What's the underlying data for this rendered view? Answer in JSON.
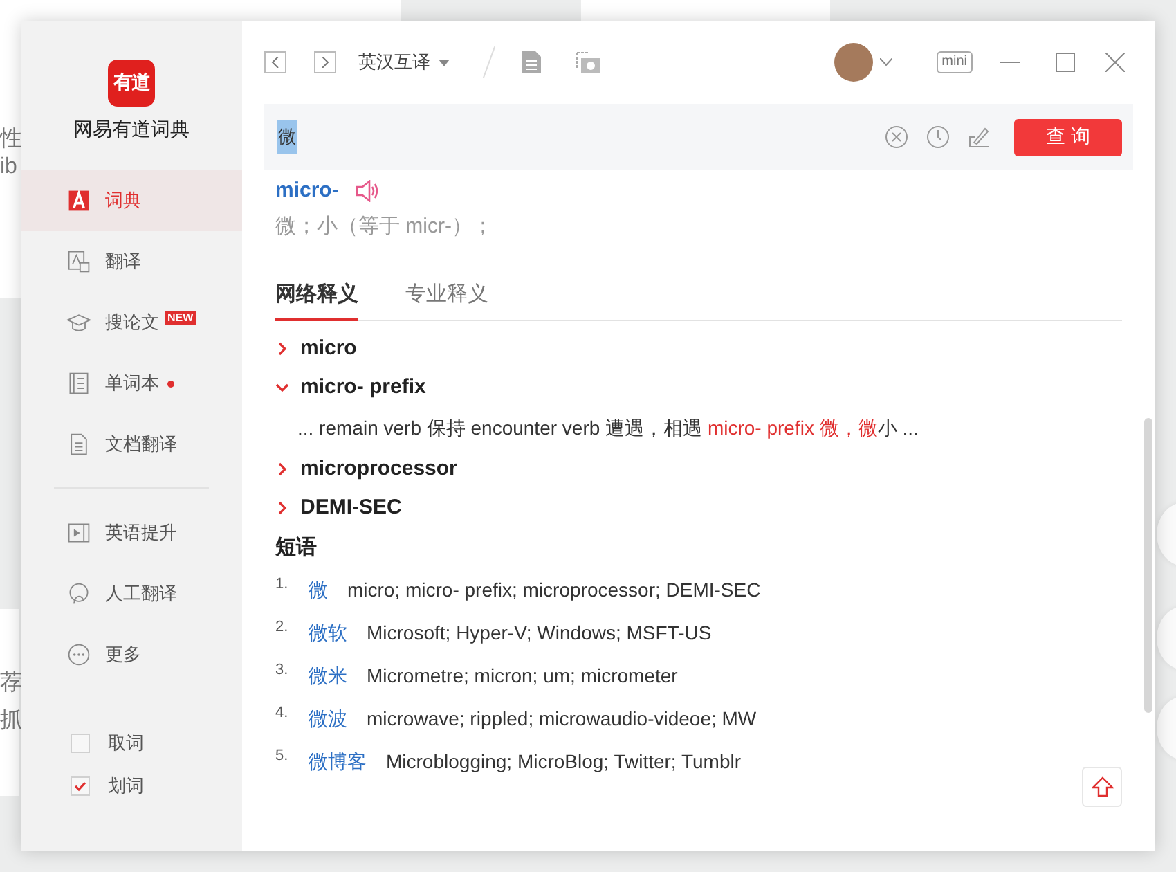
{
  "background": {
    "texts": [
      "性",
      "ib",
      "荐",
      "抓"
    ]
  },
  "app": {
    "logo": "有道",
    "name": "网易有道词典"
  },
  "sidebar": {
    "items": [
      {
        "label": "词典",
        "kind": "dict",
        "selected": true,
        "dot": false
      },
      {
        "label": "翻译",
        "kind": "translate",
        "selected": false,
        "dot": false
      },
      {
        "label": "搜论文",
        "kind": "paper",
        "selected": false,
        "badge": "NEW",
        "dot": false
      },
      {
        "label": "单词本",
        "kind": "wordbook",
        "selected": false,
        "dot": true
      },
      {
        "label": "文档翻译",
        "kind": "doc",
        "selected": false,
        "dot": false
      }
    ],
    "more_items": [
      {
        "label": "英语提升",
        "kind": "video",
        "selected": false,
        "dot": false
      },
      {
        "label": "人工翻译",
        "kind": "human",
        "selected": false,
        "dot": false
      },
      {
        "label": "更多",
        "kind": "more",
        "selected": false,
        "dot": false
      }
    ],
    "options": [
      {
        "label": "取词",
        "checked": false
      },
      {
        "label": "划词",
        "checked": true
      }
    ]
  },
  "toolbar": {
    "language": "英汉互译",
    "mini": "mini"
  },
  "search": {
    "value": "微",
    "button": "查 询"
  },
  "entry": {
    "word": "micro-",
    "definition": "微；小（等于 micr-）；"
  },
  "tabs": [
    {
      "label": "网络释义",
      "selected": true
    },
    {
      "label": "专业释义",
      "selected": false
    }
  ],
  "web_meanings": [
    {
      "term": "micro",
      "expanded": false
    },
    {
      "term": "micro- prefix",
      "expanded": true,
      "example": [
        {
          "text": "... remain verb 保持 encounter verb 遭遇，相遇 ",
          "highlight": false
        },
        {
          "text": "micro- prefix 微，",
          "highlight": true
        },
        {
          "text": "微",
          "highlight": true
        },
        {
          "text": "小 ...",
          "highlight": false
        }
      ]
    },
    {
      "term": "microprocessor",
      "expanded": false
    },
    {
      "term": "DEMI-SEC",
      "expanded": false
    }
  ],
  "phrases": {
    "title": "短语",
    "items": [
      {
        "number": "1.",
        "term": "微",
        "translation": "micro;  micro- prefix;  microprocessor;  DEMI-SEC"
      },
      {
        "number": "2.",
        "term": "微软",
        "translation": "Microsoft;  Hyper-V;  Windows;  MSFT-US"
      },
      {
        "number": "3.",
        "term": "微米",
        "translation": "Micrometre;  micron;  um;  micrometer"
      },
      {
        "number": "4.",
        "term": "微波",
        "translation": "microwave;  rippled;  microwaudio-videoe;  MW"
      },
      {
        "number": "5.",
        "term": "微博客",
        "translation": "Microblogging;  MicroBlog;  Twitter;  Tumblr"
      }
    ]
  }
}
